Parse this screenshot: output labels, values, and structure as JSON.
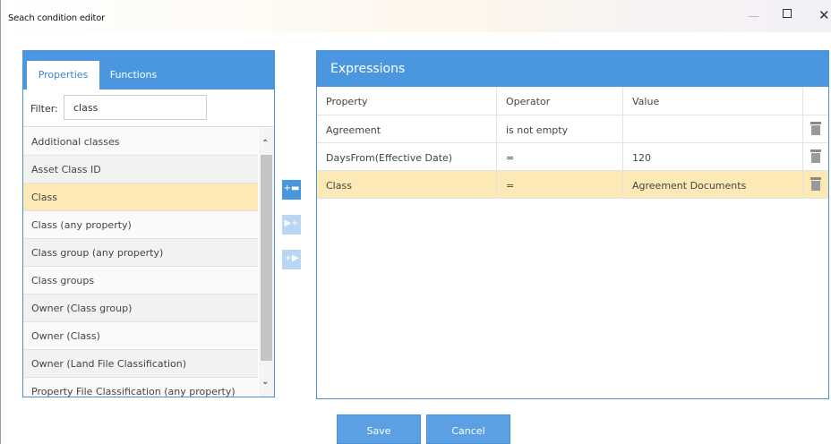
{
  "window": {
    "title": "Seach condition editor",
    "controls": {
      "minimize": "—",
      "maximize": "",
      "close": "✕"
    }
  },
  "left_panel": {
    "tabs": [
      {
        "label": "Properties",
        "active": true
      },
      {
        "label": "Functions",
        "active": false
      }
    ],
    "filter": {
      "label": "Filter:",
      "value": "class"
    },
    "items": [
      {
        "label": "Additional classes",
        "selected": false
      },
      {
        "label": "Asset Class ID",
        "selected": false
      },
      {
        "label": "Class",
        "selected": true
      },
      {
        "label": "Class (any property)",
        "selected": false
      },
      {
        "label": "Class group (any property)",
        "selected": false
      },
      {
        "label": "Class groups",
        "selected": false
      },
      {
        "label": "Owner (Class group)",
        "selected": false
      },
      {
        "label": "Owner (Class)",
        "selected": false
      },
      {
        "label": "Owner (Land File Classification)",
        "selected": false
      },
      {
        "label": "Property File Classification (any property)",
        "selected": false
      }
    ]
  },
  "middle_buttons": [
    {
      "icon": "add-expression-icon",
      "glyph": "+▬",
      "enabled": true
    },
    {
      "icon": "move-right-icon",
      "glyph": "▶+",
      "enabled": false
    },
    {
      "icon": "insert-icon",
      "glyph": "+▶",
      "enabled": false
    }
  ],
  "right_panel": {
    "title": "Expressions",
    "columns": [
      "Property",
      "Operator",
      "Value"
    ],
    "rows": [
      {
        "property": "Agreement",
        "operator": "is not empty",
        "value": "",
        "selected": false
      },
      {
        "property": "DaysFrom(Effective Date)",
        "operator": "=",
        "value": "120",
        "selected": false
      },
      {
        "property": "Class",
        "operator": "=",
        "value": "Agreement Documents",
        "selected": true
      }
    ]
  },
  "buttons": {
    "save": "Save",
    "cancel": "Cancel"
  },
  "colors": {
    "accent": "#4a97e0",
    "selection": "#fde9b6"
  }
}
